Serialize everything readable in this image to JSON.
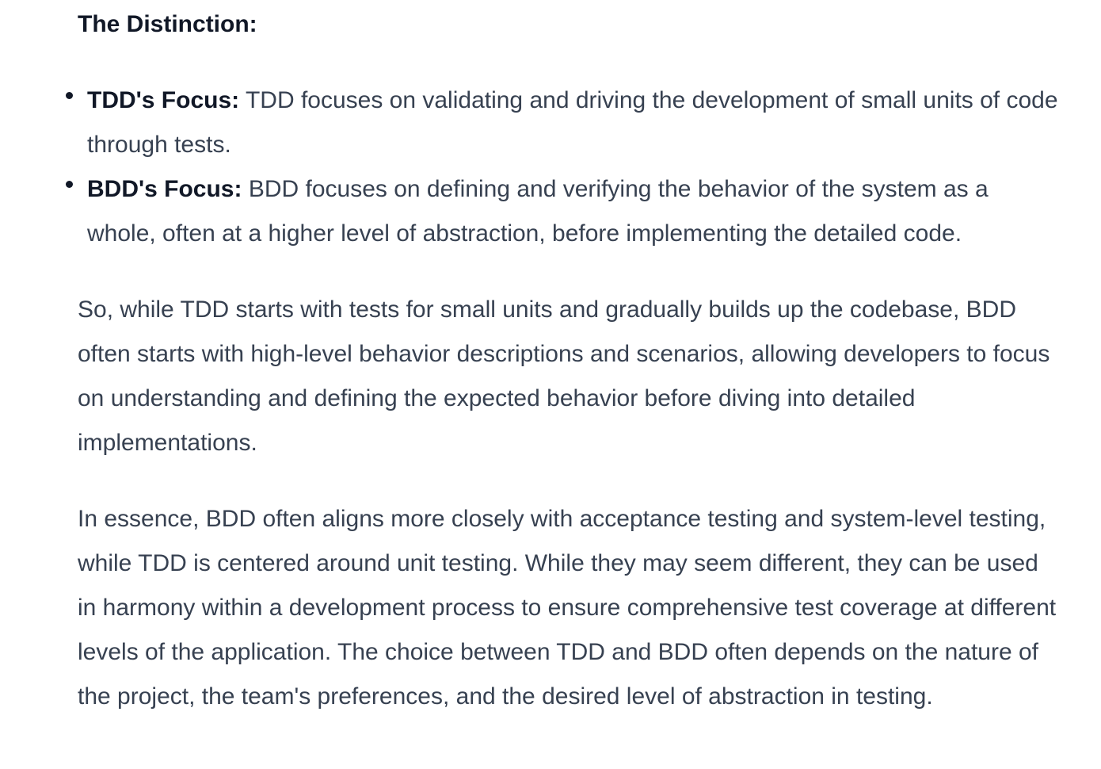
{
  "section": {
    "heading": "The Distinction:"
  },
  "bullets": [
    {
      "term": "TDD's Focus:",
      "text": " TDD focuses on validating and driving the development of small units of code through tests."
    },
    {
      "term": "BDD's Focus:",
      "text": " BDD focuses on defining and verifying the behavior of the system as a whole, often at a higher level of abstraction, before implementing the detailed code."
    }
  ],
  "paragraphs": [
    "So, while TDD starts with tests for small units and gradually builds up the codebase, BDD often starts with high-level behavior descriptions and scenarios, allowing developers to focus on understanding and defining the expected behavior before diving into detailed implementations.",
    "In essence, BDD often aligns more closely with acceptance testing and system-level testing, while TDD is centered around unit testing. While they may seem different, they can be used in harmony within a development process to ensure comprehensive test coverage at different levels of the application. The choice between TDD and BDD often depends on the nature of the project, the team's preferences, and the desired level of abstraction in testing."
  ],
  "colors": {
    "body_text": "#374151",
    "emphasis_text": "#111827",
    "background": "#ffffff"
  }
}
